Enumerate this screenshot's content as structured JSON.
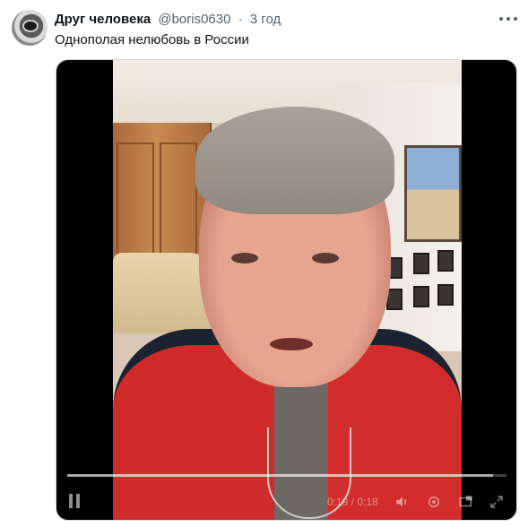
{
  "tweet": {
    "author_name": "Друг человека",
    "handle": "@boris0630",
    "separator": "·",
    "time": "3 год",
    "text": "Однополая нелюбовь в России"
  },
  "icons": {
    "more": "more-horizontal-icon",
    "pause": "pause-icon",
    "volume": "volume-icon",
    "settings": "gear-icon",
    "pip": "picture-in-picture-icon",
    "fullscreen": "fullscreen-icon"
  },
  "video": {
    "timer": "0:19 / 0:18",
    "progress_fraction": 0.97
  },
  "colors": {
    "text_primary": "#0f1419",
    "text_secondary": "#536471",
    "media_border": "#cfd9de",
    "jacket_red": "#cf2b2b"
  }
}
